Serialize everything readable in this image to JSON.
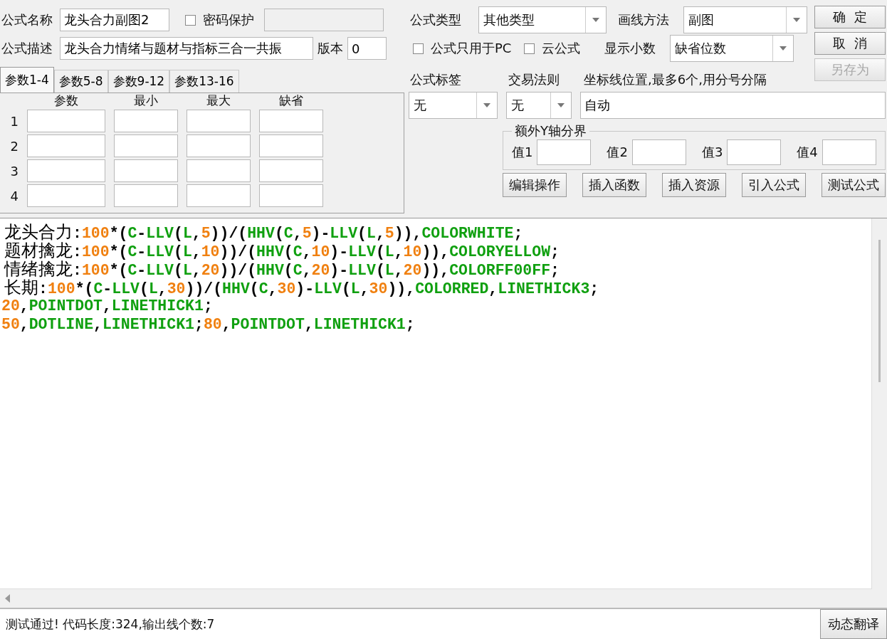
{
  "formula_name": {
    "label": "公式名称",
    "value": "龙头合力副图2"
  },
  "password": {
    "label": "密码保护",
    "checked": false
  },
  "description": {
    "label": "公式描述",
    "value": "龙头合力情绪与题材与指标三合一共振"
  },
  "version": {
    "label": "版本",
    "value": "0"
  },
  "formula_type": {
    "label": "公式类型",
    "value": "其他类型"
  },
  "draw_method": {
    "label": "画线方法",
    "value": "副图"
  },
  "options": [
    {
      "label": "公式只用于PC",
      "checked": false
    },
    {
      "label": "云公式",
      "checked": false
    }
  ],
  "decimals": {
    "label": "显示小数",
    "value": "缺省位数"
  },
  "buttons": [
    {
      "label": "确  定",
      "disabled": false
    },
    {
      "label": "取  消",
      "disabled": false
    },
    {
      "label": "另存为",
      "disabled": true
    }
  ],
  "param_tabs": [
    {
      "label": "参数1-4",
      "selected": true
    },
    {
      "label": "参数5-8",
      "selected": false
    },
    {
      "label": "参数9-12",
      "selected": false
    },
    {
      "label": "参数13-16",
      "selected": false
    }
  ],
  "param_columns": [
    "参数",
    "最小",
    "最大",
    "缺省"
  ],
  "param_rows": [
    "1",
    "2",
    "3",
    "4"
  ],
  "tag": {
    "label": "公式标签",
    "value": "无"
  },
  "trade_rule": {
    "label": "交易法则",
    "value": "无"
  },
  "axis_lines": {
    "label": "坐标线位置,最多6个,用分号分隔",
    "value": "自动"
  },
  "y_bounds": {
    "title": "额外Y轴分界",
    "fields": [
      "值1",
      "值2",
      "值3",
      "值4"
    ]
  },
  "actions": [
    "编辑操作",
    "插入函数",
    "插入资源",
    "引入公式",
    "测试公式"
  ],
  "code_lines": [
    "龙头合力:100*(C-LLV(L,5))/(HHV(C,5)-LLV(L,5)),COLORWHITE;",
    "题材擒龙:100*(C-LLV(L,10))/(HHV(C,10)-LLV(L,10)),COLORYELLOW;",
    "情绪擒龙:100*(C-LLV(L,20))/(HHV(C,20)-LLV(L,20)),COLORFF00FF;",
    "长期:100*(C-LLV(L,30))/(HHV(C,30)-LLV(L,30)),COLORRED,LINETHICK3;",
    "20,POINTDOT,LINETHICK1;",
    "50,DOTLINE,LINETHICK1;80,POINTDOT,LINETHICK1;"
  ],
  "status": "测试通过! 代码长度:324,输出线个数:7",
  "translate_button": "动态翻译"
}
